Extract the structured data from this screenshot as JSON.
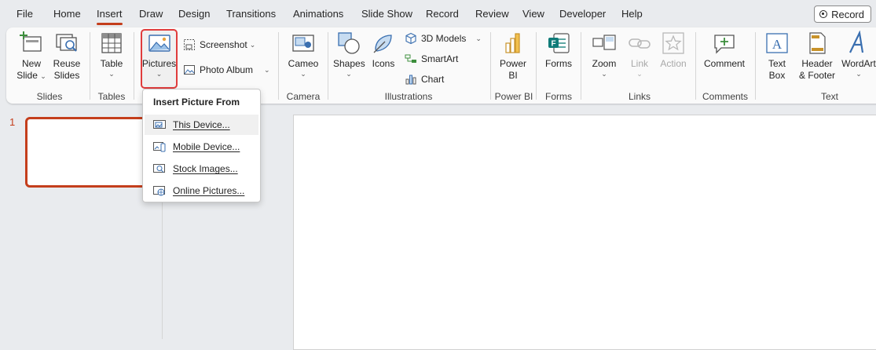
{
  "tabs": [
    "File",
    "Home",
    "Insert",
    "Draw",
    "Design",
    "Transitions",
    "Animations",
    "Slide Show",
    "Record",
    "Review",
    "View",
    "Developer",
    "Help"
  ],
  "active_tab": "Insert",
  "record_button": "Record",
  "ribbon": {
    "slides": {
      "new_slide_1": "New",
      "new_slide_2": "Slide",
      "reuse_1": "Reuse",
      "reuse_2": "Slides",
      "label": "Slides"
    },
    "tables": {
      "table": "Table",
      "label": "Tables"
    },
    "images": {
      "pictures": "Pictures",
      "screenshot": "Screenshot",
      "photo_album": "Photo Album"
    },
    "camera": {
      "cameo": "Cameo",
      "label": "Camera"
    },
    "illustrations": {
      "shapes": "Shapes",
      "icons": "Icons",
      "models_3d": "3D Models",
      "smartart": "SmartArt",
      "chart": "Chart",
      "label": "Illustrations"
    },
    "powerbi": {
      "line1": "Power",
      "line2": "BI",
      "label": "Power BI"
    },
    "forms": {
      "forms": "Forms",
      "label": "Forms"
    },
    "links": {
      "zoom": "Zoom",
      "link": "Link",
      "action": "Action",
      "label": "Links"
    },
    "comments": {
      "comment": "Comment",
      "label": "Comments"
    },
    "text": {
      "textbox_1": "Text",
      "textbox_2": "Box",
      "header_1": "Header",
      "header_2": "& Footer",
      "wordart": "WordArt",
      "label": "Text"
    }
  },
  "slide_thumbnail_number": "1",
  "insert_picture_menu": {
    "title": "Insert Picture From",
    "items": [
      "This Device...",
      "Mobile Device...",
      "Stock Images...",
      "Online Pictures..."
    ]
  },
  "colors": {
    "accent": "#c43e1c",
    "highlight": "#e03c3c"
  }
}
